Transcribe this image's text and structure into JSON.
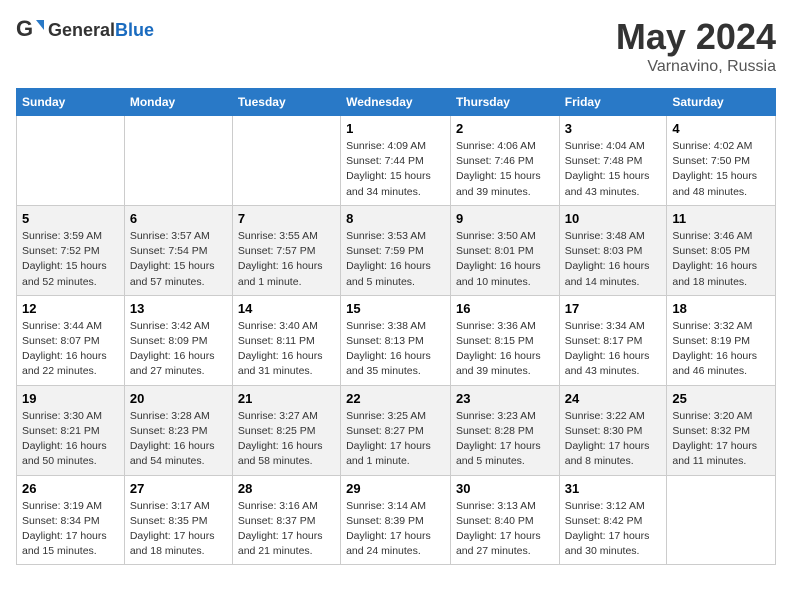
{
  "header": {
    "logo_general": "General",
    "logo_blue": "Blue",
    "title": "May 2024",
    "location": "Varnavino, Russia"
  },
  "days_of_week": [
    "Sunday",
    "Monday",
    "Tuesday",
    "Wednesday",
    "Thursday",
    "Friday",
    "Saturday"
  ],
  "weeks": [
    [
      {
        "day": "",
        "info": ""
      },
      {
        "day": "",
        "info": ""
      },
      {
        "day": "",
        "info": ""
      },
      {
        "day": "1",
        "info": "Sunrise: 4:09 AM\nSunset: 7:44 PM\nDaylight: 15 hours\nand 34 minutes."
      },
      {
        "day": "2",
        "info": "Sunrise: 4:06 AM\nSunset: 7:46 PM\nDaylight: 15 hours\nand 39 minutes."
      },
      {
        "day": "3",
        "info": "Sunrise: 4:04 AM\nSunset: 7:48 PM\nDaylight: 15 hours\nand 43 minutes."
      },
      {
        "day": "4",
        "info": "Sunrise: 4:02 AM\nSunset: 7:50 PM\nDaylight: 15 hours\nand 48 minutes."
      }
    ],
    [
      {
        "day": "5",
        "info": "Sunrise: 3:59 AM\nSunset: 7:52 PM\nDaylight: 15 hours\nand 52 minutes."
      },
      {
        "day": "6",
        "info": "Sunrise: 3:57 AM\nSunset: 7:54 PM\nDaylight: 15 hours\nand 57 minutes."
      },
      {
        "day": "7",
        "info": "Sunrise: 3:55 AM\nSunset: 7:57 PM\nDaylight: 16 hours\nand 1 minute."
      },
      {
        "day": "8",
        "info": "Sunrise: 3:53 AM\nSunset: 7:59 PM\nDaylight: 16 hours\nand 5 minutes."
      },
      {
        "day": "9",
        "info": "Sunrise: 3:50 AM\nSunset: 8:01 PM\nDaylight: 16 hours\nand 10 minutes."
      },
      {
        "day": "10",
        "info": "Sunrise: 3:48 AM\nSunset: 8:03 PM\nDaylight: 16 hours\nand 14 minutes."
      },
      {
        "day": "11",
        "info": "Sunrise: 3:46 AM\nSunset: 8:05 PM\nDaylight: 16 hours\nand 18 minutes."
      }
    ],
    [
      {
        "day": "12",
        "info": "Sunrise: 3:44 AM\nSunset: 8:07 PM\nDaylight: 16 hours\nand 22 minutes."
      },
      {
        "day": "13",
        "info": "Sunrise: 3:42 AM\nSunset: 8:09 PM\nDaylight: 16 hours\nand 27 minutes."
      },
      {
        "day": "14",
        "info": "Sunrise: 3:40 AM\nSunset: 8:11 PM\nDaylight: 16 hours\nand 31 minutes."
      },
      {
        "day": "15",
        "info": "Sunrise: 3:38 AM\nSunset: 8:13 PM\nDaylight: 16 hours\nand 35 minutes."
      },
      {
        "day": "16",
        "info": "Sunrise: 3:36 AM\nSunset: 8:15 PM\nDaylight: 16 hours\nand 39 minutes."
      },
      {
        "day": "17",
        "info": "Sunrise: 3:34 AM\nSunset: 8:17 PM\nDaylight: 16 hours\nand 43 minutes."
      },
      {
        "day": "18",
        "info": "Sunrise: 3:32 AM\nSunset: 8:19 PM\nDaylight: 16 hours\nand 46 minutes."
      }
    ],
    [
      {
        "day": "19",
        "info": "Sunrise: 3:30 AM\nSunset: 8:21 PM\nDaylight: 16 hours\nand 50 minutes."
      },
      {
        "day": "20",
        "info": "Sunrise: 3:28 AM\nSunset: 8:23 PM\nDaylight: 16 hours\nand 54 minutes."
      },
      {
        "day": "21",
        "info": "Sunrise: 3:27 AM\nSunset: 8:25 PM\nDaylight: 16 hours\nand 58 minutes."
      },
      {
        "day": "22",
        "info": "Sunrise: 3:25 AM\nSunset: 8:27 PM\nDaylight: 17 hours\nand 1 minute."
      },
      {
        "day": "23",
        "info": "Sunrise: 3:23 AM\nSunset: 8:28 PM\nDaylight: 17 hours\nand 5 minutes."
      },
      {
        "day": "24",
        "info": "Sunrise: 3:22 AM\nSunset: 8:30 PM\nDaylight: 17 hours\nand 8 minutes."
      },
      {
        "day": "25",
        "info": "Sunrise: 3:20 AM\nSunset: 8:32 PM\nDaylight: 17 hours\nand 11 minutes."
      }
    ],
    [
      {
        "day": "26",
        "info": "Sunrise: 3:19 AM\nSunset: 8:34 PM\nDaylight: 17 hours\nand 15 minutes."
      },
      {
        "day": "27",
        "info": "Sunrise: 3:17 AM\nSunset: 8:35 PM\nDaylight: 17 hours\nand 18 minutes."
      },
      {
        "day": "28",
        "info": "Sunrise: 3:16 AM\nSunset: 8:37 PM\nDaylight: 17 hours\nand 21 minutes."
      },
      {
        "day": "29",
        "info": "Sunrise: 3:14 AM\nSunset: 8:39 PM\nDaylight: 17 hours\nand 24 minutes."
      },
      {
        "day": "30",
        "info": "Sunrise: 3:13 AM\nSunset: 8:40 PM\nDaylight: 17 hours\nand 27 minutes."
      },
      {
        "day": "31",
        "info": "Sunrise: 3:12 AM\nSunset: 8:42 PM\nDaylight: 17 hours\nand 30 minutes."
      },
      {
        "day": "",
        "info": ""
      }
    ]
  ]
}
